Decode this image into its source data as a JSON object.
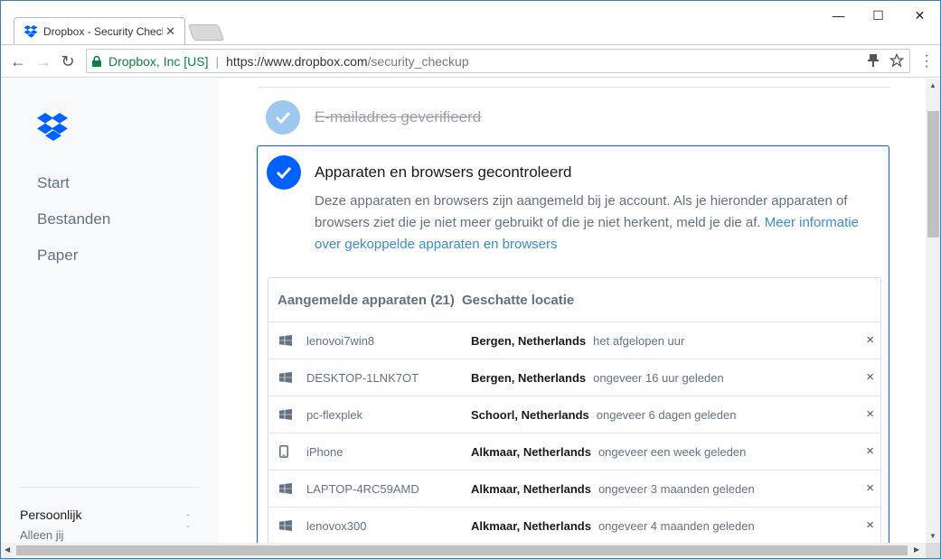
{
  "browser": {
    "tab_title": "Dropbox - Security Check",
    "tab_close": "✕",
    "window_minimize": "—",
    "window_maximize": "☐",
    "window_close": "✕",
    "back_icon": "←",
    "forward_icon": "→",
    "reload_icon": "↻",
    "secure_label": "Dropbox, Inc [US]",
    "url_host": "https://www.dropbox.com",
    "url_path": "/security_checkup"
  },
  "sidebar": {
    "items": [
      {
        "label": "Start"
      },
      {
        "label": "Bestanden"
      },
      {
        "label": "Paper"
      }
    ],
    "account_name": "Persoonlijk",
    "account_sub": "Alleen jij"
  },
  "main": {
    "done_step_label": "E-mailadres geverifieerd",
    "card": {
      "title": "Apparaten en browsers gecontroleerd",
      "description": "Deze apparaten en browsers zijn aangemeld bij je account. Als je hieronder apparaten of browsers ziet die je niet meer gebruikt of die je niet herkent, meld je die af.",
      "link": "Meer informatie over gekoppelde apparaten en browsers",
      "table": {
        "col_device": "Aangemelde apparaten (21)",
        "col_location": "Geschatte locatie",
        "rows": [
          {
            "icon": "windows-icon",
            "device": "lenovoi7win8",
            "location": "Bergen, Netherlands",
            "when": "het afgelopen uur"
          },
          {
            "icon": "windows-icon",
            "device": "DESKTOP-1LNK7OT",
            "location": "Bergen, Netherlands",
            "when": "ongeveer 16 uur geleden"
          },
          {
            "icon": "windows-icon",
            "device": "pc-flexplek",
            "location": "Schoorl, Netherlands",
            "when": "ongeveer 6 dagen geleden"
          },
          {
            "icon": "phone-icon",
            "device": "iPhone",
            "location": "Alkmaar, Netherlands",
            "when": "ongeveer een week geleden"
          },
          {
            "icon": "windows-icon",
            "device": "LAPTOP-4RC59AMD",
            "location": "Alkmaar, Netherlands",
            "when": "ongeveer 3 maanden geleden"
          },
          {
            "icon": "windows-icon",
            "device": "lenovox300",
            "location": "Alkmaar, Netherlands",
            "when": "ongeveer 4 maanden geleden"
          }
        ],
        "remove_symbol": "×"
      }
    }
  },
  "colors": {
    "accent": "#0061fe",
    "accent_light": "#9fc8f1",
    "link": "#3d8cd8",
    "secure": "#0b8043"
  }
}
